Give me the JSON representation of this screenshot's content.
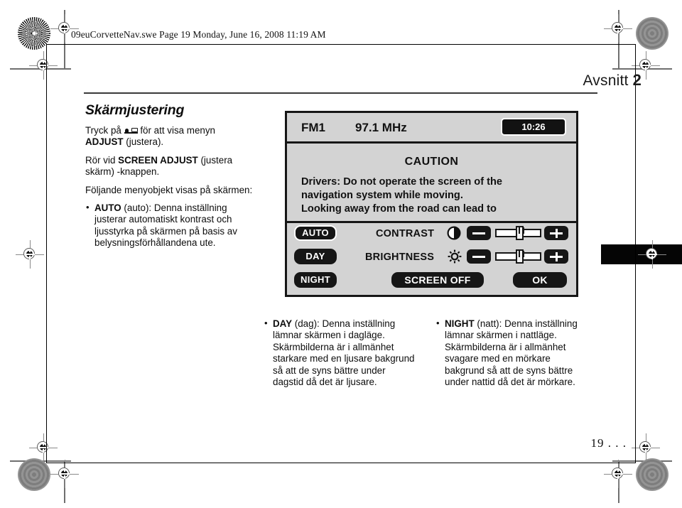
{
  "file_banner": "09euCorvetteNav.swe  Page 19  Monday, June 16, 2008  11:19 AM",
  "header": {
    "section_label": "Avsnitt",
    "section_number": "2"
  },
  "left_column": {
    "title": "Skärmjustering",
    "paragraph_1_pre": "Tryck på",
    "paragraph_1_post_bold": "ADJUST",
    "paragraph_1_post": " för att visa menyn",
    "paragraph_1_tail": " (justera).",
    "paragraph_2_pre": "Rör vid ",
    "paragraph_2_bold": "SCREEN ADJUST",
    "paragraph_2_post": " (justera skärm) -knappen.",
    "paragraph_3": "Följande menyobjekt visas på skärmen:",
    "bullet_auto_bold": "AUTO",
    "bullet_auto_text": " (auto): Denna inställning justerar automatiskt kontrast och ljusstyrka på skärmen på basis av belysningsförhållandena ute."
  },
  "nav_screen": {
    "band": "FM1",
    "frequency": "97.1 MHz",
    "clock": "10:26",
    "caution_title": "CAUTION",
    "caution_line_1": "Drivers: Do not operate the screen of the",
    "caution_line_2": "navigation system while moving.",
    "caution_line_3": "Looking away from the road can lead to",
    "buttons": {
      "auto": "AUTO",
      "day": "DAY",
      "night": "NIGHT",
      "screen_off": "SCREEN OFF",
      "ok": "OK"
    },
    "controls": {
      "contrast_label": "CONTRAST",
      "brightness_label": "BRIGHTNESS",
      "contrast_value_percent": 45,
      "brightness_value_percent": 45,
      "minus_label": "−",
      "plus_label": "+"
    },
    "colors": {
      "screen_background": "#d3d3d3",
      "chrome": "#161616",
      "clock_background": "#121212"
    }
  },
  "bottom_columns": [
    {
      "bold": "DAY",
      "text": " (dag): Denna inställning lämnar skärmen i dagläge. Skärmbilderna är i allmänhet starkare med en ljusare bakgrund så att de syns bättre under dagstid då det är ljusare."
    },
    {
      "bold": "NIGHT",
      "text": " (natt): Denna inställning lämnar skärmen i nattläge. Skärmbilderna är i allmänhet svagare med en mörkare bakgrund så att de syns bättre under nattid då det är mörkare."
    }
  ],
  "folio": "19 . . ."
}
